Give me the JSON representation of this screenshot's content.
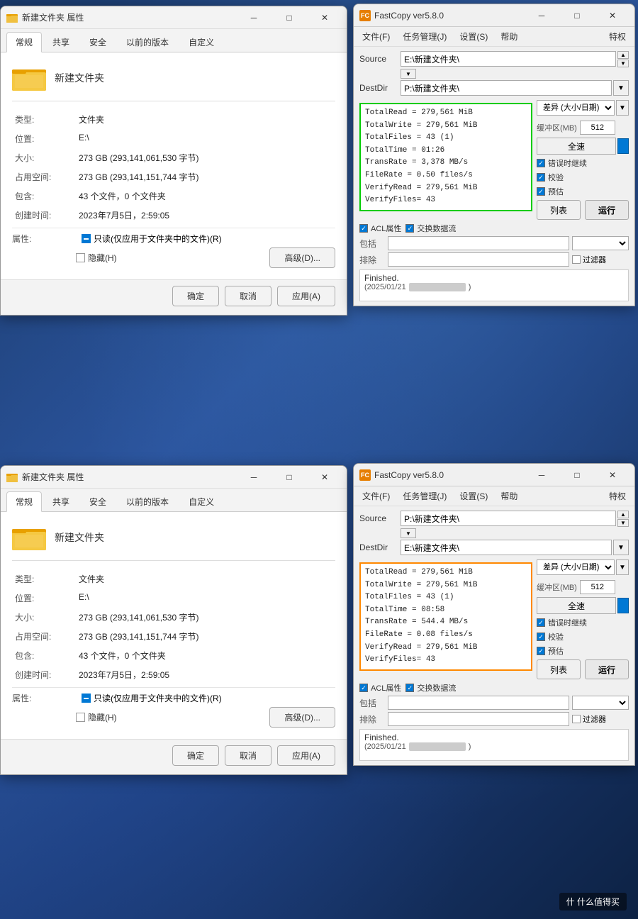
{
  "top_left": {
    "title": "新建文件夹 属性",
    "tabs": [
      "常规",
      "共享",
      "安全",
      "以前的版本",
      "自定义"
    ],
    "active_tab": "常规",
    "folder_name": "新建文件夹",
    "props": [
      {
        "label": "类型:",
        "value": "文件夹"
      },
      {
        "label": "位置:",
        "value": "E:\\"
      },
      {
        "label": "大小:",
        "value": "273 GB (293,141,061,530 字节)"
      },
      {
        "label": "占用空间:",
        "value": "273 GB (293,141,151,744 字节)"
      },
      {
        "label": "包含:",
        "value": "43 个文件，0 个文件夹"
      },
      {
        "label": "创建时间:",
        "value": "2023年7月5日，2:59:05"
      }
    ],
    "attr_label": "属性:",
    "readonly_label": "只读(仅应用于文件夹中的文件)(R)",
    "hidden_label": "隐藏(H)",
    "advanced_btn": "高级(D)...",
    "ok_btn": "确定",
    "cancel_btn": "取消",
    "apply_btn": "应用(A)"
  },
  "top_right": {
    "title": "FastCopy ver5.8.0",
    "menu": [
      "文件(F)",
      "任务管理(J)",
      "设置(S)",
      "帮助",
      "特权"
    ],
    "source_label": "Source",
    "source_value": "E:\\新建文件夹\\",
    "destdir_label": "DestDir",
    "destdir_value": "P:\\新建文件夹\\",
    "stats": {
      "lines": [
        "TotalRead  = 279,561 MiB",
        "TotalWrite = 279,561 MiB",
        "TotalFiles = 43 (1)",
        "TotalTime  = 01:26",
        "TransRate  = 3,378 MB/s",
        "FileRate   = 0.50 files/s",
        "VerifyRead = 279,561 MiB",
        "VerifyFiles= 43"
      ],
      "border_color": "green"
    },
    "mode_label": "差异 (大小/日期)",
    "buffer_label": "缓冲区(MB)",
    "buffer_value": "512",
    "speed_label": "全速",
    "error_continue_label": "错误时继续",
    "verify_label": "校验",
    "preview_label": "预估",
    "list_btn": "列表",
    "run_btn": "运行",
    "acl_label": "ACL属性",
    "stream_label": "交换数据流",
    "include_label": "包括",
    "exclude_label": "排除",
    "filter_label": "过滤器",
    "status_text": "Finished.",
    "status_date": "(2025/01/21"
  },
  "bottom_left": {
    "title": "新建文件夹 属性",
    "tabs": [
      "常规",
      "共享",
      "安全",
      "以前的版本",
      "自定义"
    ],
    "active_tab": "常规",
    "folder_name": "新建文件夹",
    "props": [
      {
        "label": "类型:",
        "value": "文件夹"
      },
      {
        "label": "位置:",
        "value": "E:\\"
      },
      {
        "label": "大小:",
        "value": "273 GB (293,141,061,530 字节)"
      },
      {
        "label": "占用空间:",
        "value": "273 GB (293,141,151,744 字节)"
      },
      {
        "label": "包含:",
        "value": "43 个文件，0 个文件夹"
      },
      {
        "label": "创建时间:",
        "value": "2023年7月5日，2:59:05"
      }
    ],
    "attr_label": "属性:",
    "readonly_label": "只读(仅应用于文件夹中的文件)(R)",
    "hidden_label": "隐藏(H)",
    "advanced_btn": "高级(D)...",
    "ok_btn": "确定",
    "cancel_btn": "取消",
    "apply_btn": "应用(A)"
  },
  "bottom_right": {
    "title": "FastCopy ver5.8.0",
    "menu": [
      "文件(F)",
      "任务管理(J)",
      "设置(S)",
      "帮助",
      "特权"
    ],
    "source_label": "Source",
    "source_value": "P:\\新建文件夹\\",
    "destdir_label": "DestDir",
    "destdir_value": "E:\\新建文件夹\\",
    "stats": {
      "lines": [
        "TotalRead  = 279,561 MiB",
        "TotalWrite = 279,561 MiB",
        "TotalFiles = 43 (1)",
        "TotalTime  = 08:58",
        "TransRate  = 544.4 MB/s",
        "FileRate   = 0.08 files/s",
        "VerifyRead = 279,561 MiB",
        "VerifyFiles= 43"
      ],
      "border_color": "orange"
    },
    "mode_label": "差异 (大小/日期)",
    "buffer_label": "缓冲区(MB)",
    "buffer_value": "512",
    "speed_label": "全速",
    "error_continue_label": "错误时继续",
    "verify_label": "校验",
    "preview_label": "预估",
    "list_btn": "列表",
    "run_btn": "运行",
    "acl_label": "ACL属性",
    "stream_label": "交换数据流",
    "include_label": "包括",
    "exclude_label": "排除",
    "filter_label": "过滤器",
    "status_text": "Finished.",
    "status_date": "(2025/01/21"
  },
  "watermark": "什么值得买"
}
